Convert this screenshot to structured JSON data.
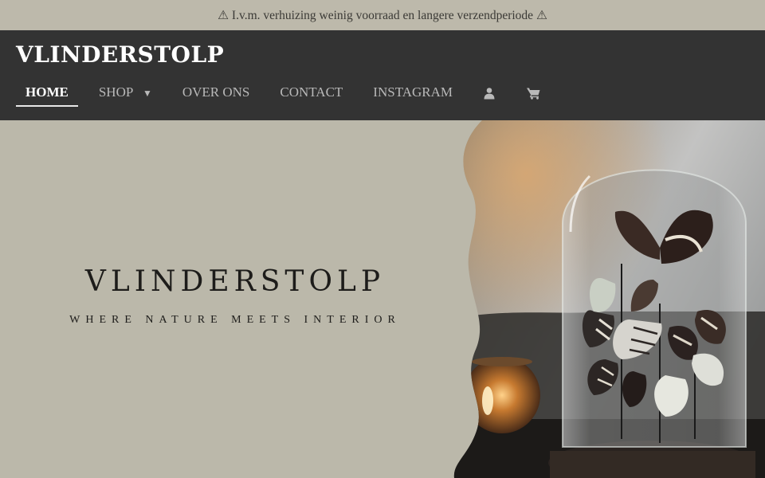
{
  "announcement": "⚠ I.v.m. verhuizing weinig voorraad en langere verzendperiode ⚠",
  "site": {
    "title": "VLINDERSTOLP"
  },
  "nav": {
    "items": [
      {
        "label": "HOME",
        "active": true
      },
      {
        "label": "SHOP"
      },
      {
        "label": "OVER ONS"
      },
      {
        "label": "CONTACT"
      },
      {
        "label": "INSTAGRAM"
      }
    ],
    "shop_caret": "▼",
    "icons": [
      "user-icon",
      "cart-icon"
    ]
  },
  "hero": {
    "brand": "VLINDERSTOLP",
    "tagline": "WHERE NATURE MEETS INTERIOR"
  },
  "colors": {
    "announcement_bg": "#bdb9ab",
    "header_bg": "#333333",
    "hero_bg": "#bbb8aa",
    "nav_text": "#b9b9b9",
    "nav_active": "#ffffff"
  }
}
